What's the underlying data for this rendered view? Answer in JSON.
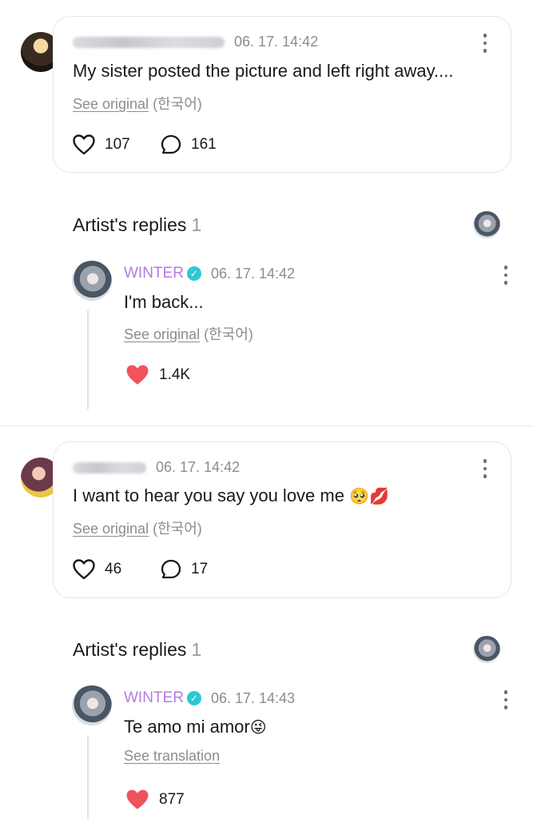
{
  "posts": [
    {
      "author": "",
      "time": "06. 17. 14:42",
      "text": "My sister posted the picture and left right away....",
      "see_original": "See original",
      "lang": "(한국어)",
      "likes": "107",
      "comments": "161",
      "reply_section": {
        "title": "Artist's replies",
        "count": "1",
        "reply": {
          "author": "WINTER",
          "time": "06. 17. 14:42",
          "text": "I'm back...",
          "see_original": "See original",
          "lang": "(한국어)",
          "likes": "1.4K"
        }
      }
    },
    {
      "author": "",
      "time": "06. 17. 14:42",
      "text": "I want to hear you say you love me",
      "emoji": "🥺💋",
      "see_original": "See original",
      "lang": "(한국어)",
      "likes": "46",
      "comments": "17",
      "reply_section": {
        "title": "Artist's replies",
        "count": "1",
        "reply": {
          "author": "WINTER",
          "time": "06. 17. 14:43",
          "text": "Te amo mi amor",
          "emoji": "😜",
          "see_translation": "See translation",
          "likes": "877"
        }
      }
    }
  ],
  "colors": {
    "artist_name": "#b57be0",
    "verified_badge": "#2ec7d6",
    "heart_filled": "#f0525e"
  }
}
